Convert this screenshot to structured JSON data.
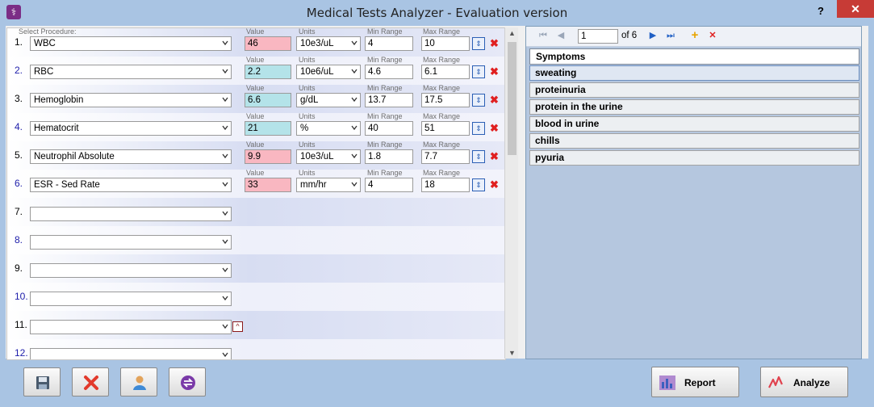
{
  "window": {
    "title": "Medical Tests Analyzer - Evaluation version",
    "help_label": "?",
    "close_label": "✕"
  },
  "labels": {
    "select_procedure": "Select Procedure:",
    "value": "Value",
    "units": "Units",
    "min_range": "Min Range",
    "max_range": "Max Range"
  },
  "tests": [
    {
      "num": "1.",
      "procedure": "WBC",
      "value": "46",
      "value_status": "high",
      "units": "10e3/uL",
      "min": "4",
      "max": "10"
    },
    {
      "num": "2.",
      "procedure": "RBC",
      "value": "2.2",
      "value_status": "low",
      "units": "10e6/uL",
      "min": "4.6",
      "max": "6.1"
    },
    {
      "num": "3.",
      "procedure": "Hemoglobin",
      "value": "6.6",
      "value_status": "low",
      "units": "g/dL",
      "min": "13.7",
      "max": "17.5"
    },
    {
      "num": "4.",
      "procedure": "Hematocrit",
      "value": "21",
      "value_status": "low",
      "units": "%",
      "min": "40",
      "max": "51"
    },
    {
      "num": "5.",
      "procedure": "Neutrophil Absolute",
      "value": "9.9",
      "value_status": "high",
      "units": "10e3/uL",
      "min": "1.8",
      "max": "7.7"
    },
    {
      "num": "6.",
      "procedure": "ESR - Sed Rate",
      "value": "33",
      "value_status": "high",
      "units": "mm/hr",
      "min": "4",
      "max": "18"
    }
  ],
  "empty_rows": [
    "7.",
    "8.",
    "9.",
    "10.",
    "11.",
    "12."
  ],
  "symptoms_nav": {
    "current": "1",
    "of_text": "of 6"
  },
  "symptoms": {
    "header": "Symptoms",
    "items": [
      "sweating",
      "proteinuria",
      "protein in the urine",
      "blood in urine",
      "chills",
      "pyuria"
    ]
  },
  "buttons": {
    "report": "Report",
    "analyze": "Analyze"
  },
  "icons": {
    "save": "floppy-disk-icon",
    "delete": "red-x-icon",
    "patient": "user-icon",
    "refresh": "swap-icon",
    "report": "bar-chart-icon",
    "analyze": "pulse-icon"
  },
  "colors": {
    "high_value": "#f9b7c1",
    "low_value": "#b4e3e9",
    "accent_blue": "#2b5fb5",
    "title_bg": "#a9c4e3"
  }
}
